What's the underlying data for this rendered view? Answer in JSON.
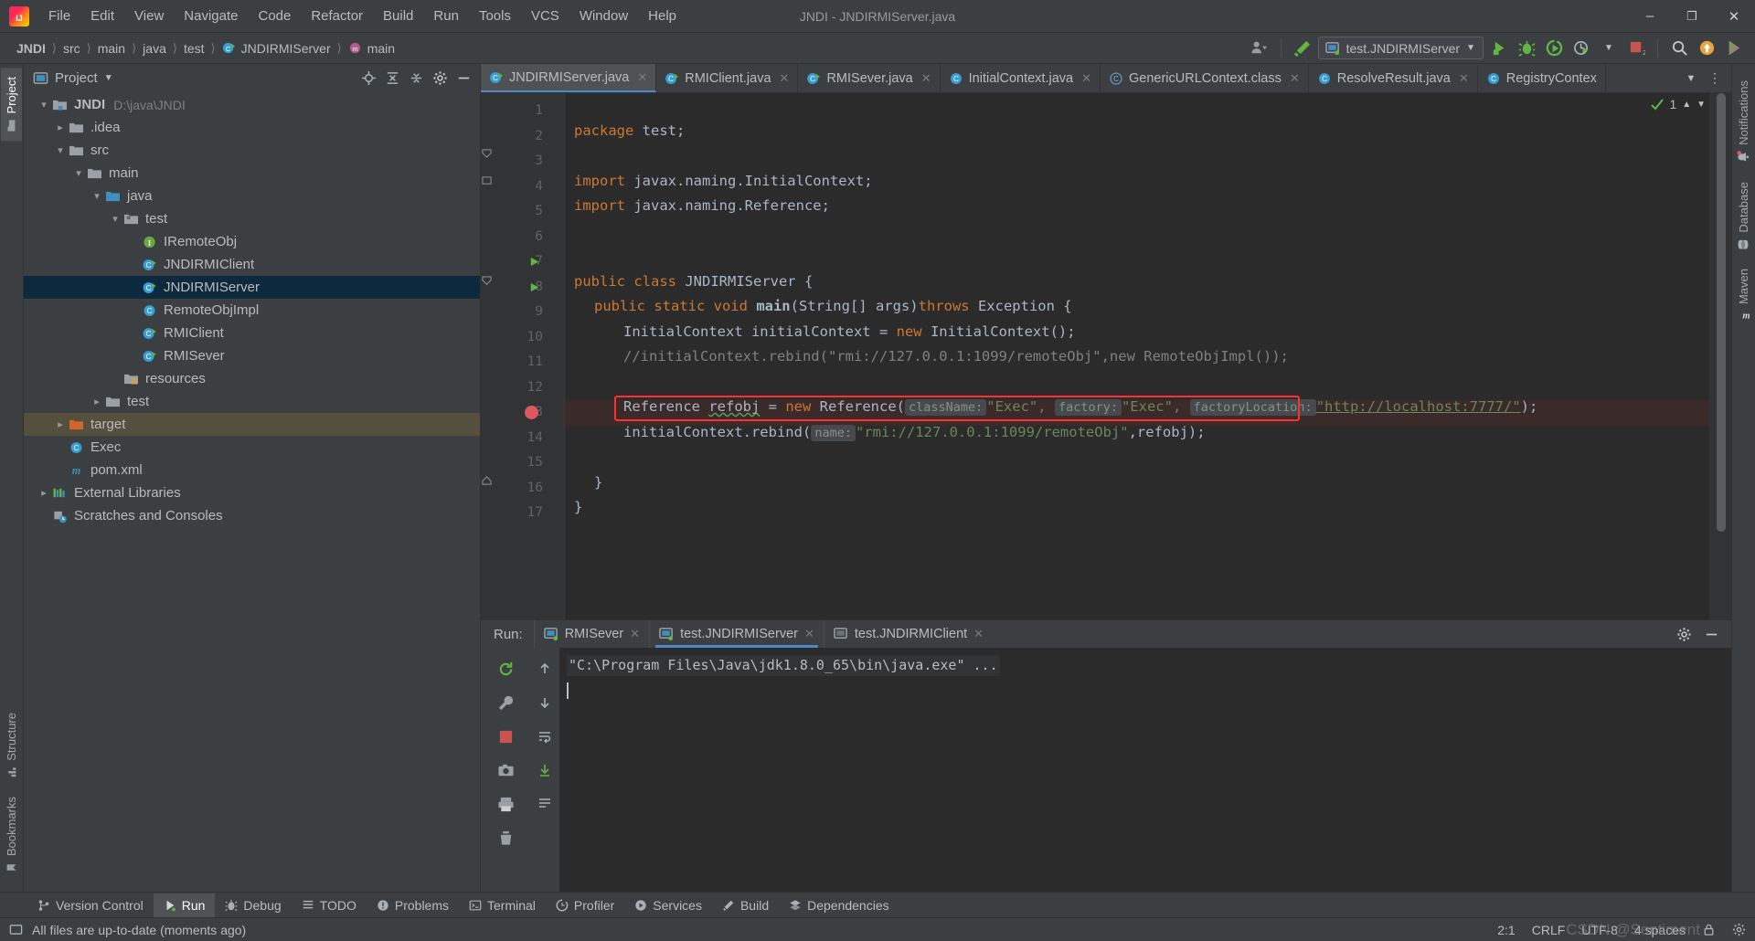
{
  "window": {
    "title": "JNDI - JNDIRMIServer.java",
    "minimize": "–",
    "maximize": "❐",
    "close": "✕"
  },
  "menu": [
    {
      "label": "File"
    },
    {
      "label": "Edit"
    },
    {
      "label": "View"
    },
    {
      "label": "Navigate"
    },
    {
      "label": "Code"
    },
    {
      "label": "Refactor"
    },
    {
      "label": "Build"
    },
    {
      "label": "Run"
    },
    {
      "label": "Tools"
    },
    {
      "label": "VCS"
    },
    {
      "label": "Window"
    },
    {
      "label": "Help"
    }
  ],
  "breadcrumb": [
    "JNDI",
    "src",
    "main",
    "java",
    "test",
    "JNDIRMIServer",
    "main"
  ],
  "toolbar": {
    "run_config": "test.JNDIRMIServer",
    "icons": [
      "user-avatar-icon",
      "build-hammer-icon",
      "run-icon",
      "debug-icon",
      "run-coverage-icon",
      "profiler-icon",
      "stop-icon",
      "search-icon",
      "update-project-icon",
      "ide-updates-icon"
    ]
  },
  "left_stripe": [
    {
      "label": "Project",
      "icon": "project-folder-icon",
      "active": true
    },
    {
      "label": "Structure",
      "icon": "structure-icon",
      "active": false
    },
    {
      "label": "Bookmarks",
      "icon": "bookmark-icon",
      "active": false
    }
  ],
  "right_stripe": [
    {
      "label": "Notifications",
      "icon": "bell-icon"
    },
    {
      "label": "Database",
      "icon": "database-icon"
    },
    {
      "label": "Maven",
      "icon": "maven-icon"
    }
  ],
  "project_panel": {
    "title": "Project",
    "header_icons": [
      "select-opened-file-icon",
      "expand-all-icon",
      "collapse-all-icon",
      "gear-icon",
      "hide-icon"
    ],
    "tree": [
      {
        "depth": 0,
        "arrow": "down",
        "icon": "module-folder-icon",
        "name": "JNDI",
        "bold": true,
        "path": "D:\\java\\JNDI",
        "state": "normal"
      },
      {
        "depth": 1,
        "arrow": "right",
        "icon": "folder-icon",
        "name": ".idea",
        "state": "normal"
      },
      {
        "depth": 1,
        "arrow": "down",
        "icon": "folder-icon",
        "name": "src",
        "state": "normal"
      },
      {
        "depth": 2,
        "arrow": "down",
        "icon": "folder-icon",
        "name": "main",
        "state": "normal"
      },
      {
        "depth": 3,
        "arrow": "down",
        "icon": "source-folder-icon",
        "name": "java",
        "state": "normal"
      },
      {
        "depth": 4,
        "arrow": "down",
        "icon": "package-folder-icon",
        "name": "test",
        "state": "normal"
      },
      {
        "depth": 5,
        "arrow": "none",
        "icon": "interface-icon",
        "name": "IRemoteObj",
        "state": "normal"
      },
      {
        "depth": 5,
        "arrow": "none",
        "icon": "class-runnable-icon",
        "name": "JNDIRMIClient",
        "state": "normal"
      },
      {
        "depth": 5,
        "arrow": "none",
        "icon": "class-runnable-icon",
        "name": "JNDIRMIServer",
        "state": "selected"
      },
      {
        "depth": 5,
        "arrow": "none",
        "icon": "class-icon",
        "name": "RemoteObjImpl",
        "state": "normal"
      },
      {
        "depth": 5,
        "arrow": "none",
        "icon": "class-runnable-icon",
        "name": "RMIClient",
        "state": "normal"
      },
      {
        "depth": 5,
        "arrow": "none",
        "icon": "class-runnable-icon",
        "name": "RMISever",
        "state": "normal"
      },
      {
        "depth": 4,
        "arrow": "none",
        "icon": "resources-folder-icon",
        "name": "resources",
        "state": "normal"
      },
      {
        "depth": 3,
        "arrow": "right",
        "icon": "folder-icon",
        "name": "test",
        "state": "normal"
      },
      {
        "depth": 1,
        "arrow": "right",
        "icon": "excluded-folder-icon",
        "name": "target",
        "state": "target"
      },
      {
        "depth": 1,
        "arrow": "none",
        "icon": "class-icon",
        "name": "Exec",
        "state": "normal"
      },
      {
        "depth": 1,
        "arrow": "none",
        "icon": "maven-file-icon",
        "name": "pom.xml",
        "state": "normal"
      },
      {
        "depth": 0,
        "arrow": "right",
        "icon": "libraries-icon",
        "name": "External Libraries",
        "state": "normal"
      },
      {
        "depth": 0,
        "arrow": "none",
        "icon": "scratches-icon",
        "name": "Scratches and Consoles",
        "state": "normal"
      }
    ]
  },
  "editor": {
    "tabs": [
      {
        "label": "JNDIRMIServer.java",
        "icon": "class-runnable-icon",
        "active": true
      },
      {
        "label": "RMIClient.java",
        "icon": "class-runnable-icon",
        "active": false
      },
      {
        "label": "RMISever.java",
        "icon": "class-runnable-icon",
        "active": false
      },
      {
        "label": "InitialContext.java",
        "icon": "class-icon",
        "active": false
      },
      {
        "label": "GenericURLContext.class",
        "icon": "class-decompiled-icon",
        "active": false
      },
      {
        "label": "ResolveResult.java",
        "icon": "class-icon",
        "active": false
      },
      {
        "label": "RegistryContex",
        "icon": "class-icon",
        "active": false
      }
    ],
    "tabs_right_icons": [
      "chevron-down-icon",
      "more-vertical-icon"
    ],
    "inspection": {
      "count": "1",
      "status_icon": "inspection-ok-icon"
    },
    "lines": [
      "1",
      "2",
      "3",
      "4",
      "5",
      "6",
      "7",
      "8",
      "9",
      "10",
      "11",
      "12",
      "13",
      "14",
      "15",
      "16",
      "17"
    ],
    "code": {
      "l1_package": "package",
      "l1_name": " test;",
      "l3_import": "import",
      "l3_name": " javax.naming.InitialContext;",
      "l4_import": "import",
      "l4_name": " javax.naming.Reference;",
      "l7": "public class JNDIRMIServer {",
      "l8": "public static void main(String[] args)throws Exception {",
      "l9": "InitialContext initialContext = new InitialContext();",
      "l10_comment": "//initialContext.rebind(\"rmi://127.0.0.1:1099/remoteObj\",new RemoteObjImpl());",
      "l12_pre": "Reference ",
      "l12_var": "refobj",
      "l12_eq": " = ",
      "l12_new": "new",
      "l12_ctor": " Reference(",
      "l12_hint1": "className:",
      "l12_arg1": "\"Exec\",",
      "l12_hint2": "factory:",
      "l12_arg2": "\"Exec\",",
      "l12_hint3": "factoryLocation:",
      "l12_arg3": "\"http://localhost:7777/\"",
      "l12_end": ");",
      "l13_pre": "initialContext.rebind(",
      "l13_hint": "name:",
      "l13_str": "\"rmi://127.0.0.1:1099/remoteObj\"",
      "l13_rest": ",refobj);",
      "l15": "}",
      "l16": "}"
    }
  },
  "run_panel": {
    "label": "Run:",
    "tabs": [
      {
        "label": "RMISever",
        "icon": "run-config-icon",
        "active": false
      },
      {
        "label": "test.JNDIRMIServer",
        "icon": "run-config-icon",
        "active": true
      },
      {
        "label": "test.JNDIRMIClient",
        "icon": "run-config-icon",
        "active": false
      }
    ],
    "right_icons": [
      "gear-icon",
      "hide-icon"
    ],
    "toolbar_icons": [
      "rerun-icon",
      "up-icon",
      "wrench-icon",
      "down-icon",
      "stop-icon",
      "wrap-text-icon",
      "camera-icon",
      "scroll-to-end-icon",
      "print-icon",
      "clear-all-icon",
      "soft-wrap-icon"
    ],
    "console_line": "\"C:\\Program Files\\Java\\jdk1.8.0_65\\bin\\java.exe\" ..."
  },
  "bottom_tabs": [
    {
      "label": "Version Control",
      "icon": "vcs-icon",
      "active": false
    },
    {
      "label": "Run",
      "icon": "run-icon",
      "active": true
    },
    {
      "label": "Debug",
      "icon": "debug-icon",
      "active": false
    },
    {
      "label": "TODO",
      "icon": "todo-icon",
      "active": false
    },
    {
      "label": "Problems",
      "icon": "problems-icon",
      "active": false
    },
    {
      "label": "Terminal",
      "icon": "terminal-icon",
      "active": false
    },
    {
      "label": "Profiler",
      "icon": "profiler-icon",
      "active": false
    },
    {
      "label": "Services",
      "icon": "services-icon",
      "active": false
    },
    {
      "label": "Build",
      "icon": "build-icon",
      "active": false
    },
    {
      "label": "Dependencies",
      "icon": "dependencies-icon",
      "active": false
    }
  ],
  "status_bar": {
    "message": "All files are up-to-date (moments ago)",
    "caret_position": "2:1",
    "line_separator": "CRLF",
    "encoding": "UTF-8",
    "indent": "4 spaces",
    "watermark": "CSDN @Sentiment"
  },
  "colors": {
    "accent": "#4a88c7",
    "selection": "#0d293e",
    "error": "#ff2f2f",
    "keyword": "#cc7832",
    "string": "#6a8759",
    "comment": "#808080",
    "background": "#2b2b2b",
    "chrome": "#3c3f41"
  }
}
